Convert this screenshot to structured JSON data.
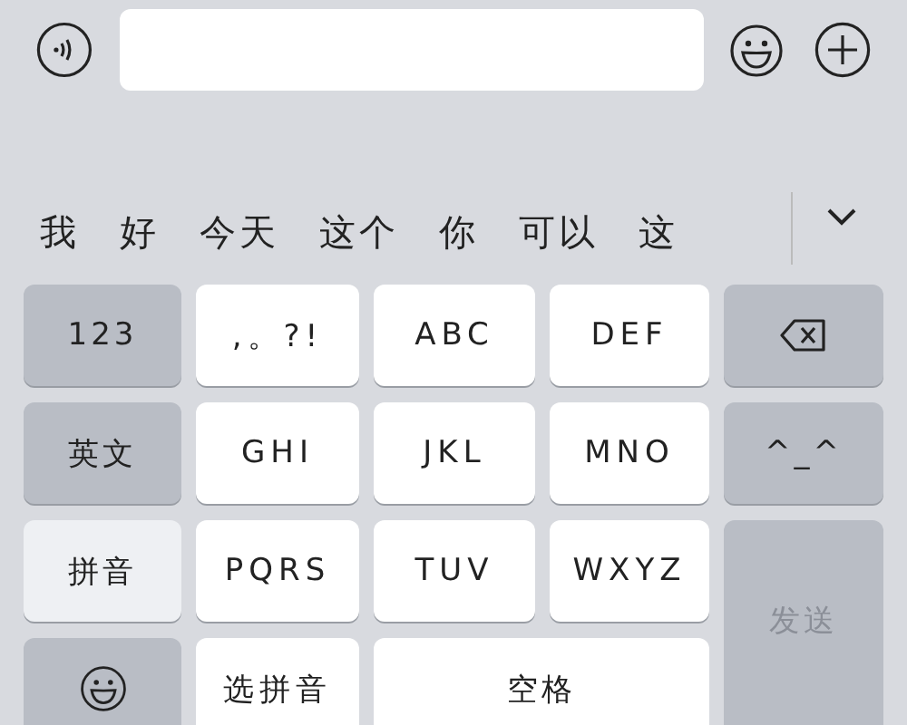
{
  "candidates": [
    "我",
    "好",
    "今天",
    "这个",
    "你",
    "可以",
    "这"
  ],
  "keys": [
    {
      "kind": "mode",
      "label": "123",
      "selected": false,
      "disabled": false
    },
    {
      "kind": "letter",
      "label": ",。?!",
      "selected": false,
      "disabled": false
    },
    {
      "kind": "letter",
      "label": "ABC",
      "selected": false,
      "disabled": false
    },
    {
      "kind": "letter",
      "label": "DEF",
      "selected": false,
      "disabled": false
    },
    {
      "kind": "backspace",
      "selected": false,
      "disabled": false
    },
    {
      "kind": "mode",
      "label": "英文",
      "selected": false,
      "disabled": false
    },
    {
      "kind": "letter",
      "label": "GHI",
      "selected": false,
      "disabled": false
    },
    {
      "kind": "letter",
      "label": "JKL",
      "selected": false,
      "disabled": false
    },
    {
      "kind": "letter",
      "label": "MNO",
      "selected": false,
      "disabled": false
    },
    {
      "kind": "mode",
      "label": "^_^",
      "selected": false,
      "disabled": false
    },
    {
      "kind": "mode",
      "label": "拼音",
      "selected": true,
      "disabled": false
    },
    {
      "kind": "letter",
      "label": "PQRS",
      "selected": false,
      "disabled": false
    },
    {
      "kind": "letter",
      "label": "TUV",
      "selected": false,
      "disabled": false
    },
    {
      "kind": "letter",
      "label": "WXYZ",
      "selected": false,
      "disabled": false
    },
    {
      "kind": "send",
      "label": "发送",
      "selected": false,
      "disabled": true
    },
    {
      "kind": "emoji",
      "selected": false,
      "disabled": false
    },
    {
      "kind": "letter",
      "label": "选拼音",
      "selected": false,
      "disabled": false
    },
    {
      "kind": "space",
      "label": "空格",
      "selected": false,
      "disabled": false
    }
  ]
}
